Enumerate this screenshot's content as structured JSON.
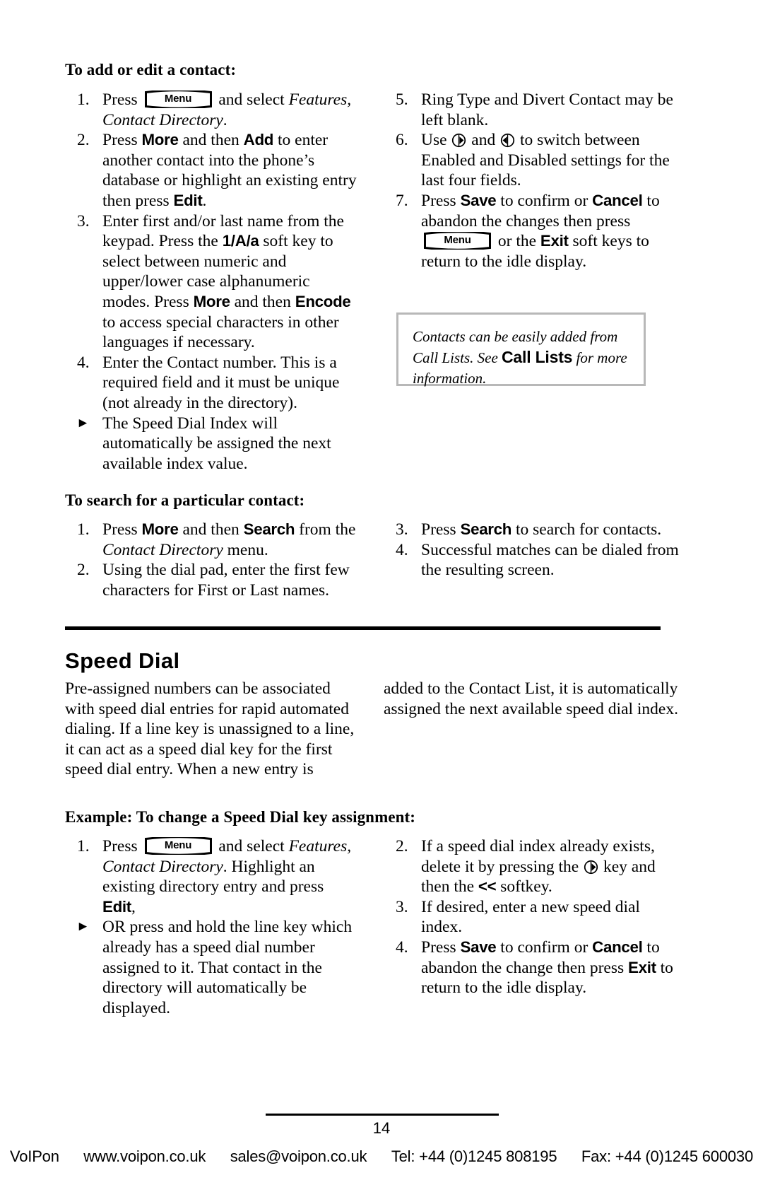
{
  "page": {
    "number": "14"
  },
  "sections": {
    "add_edit": {
      "heading": "To add or edit a contact:",
      "left_items": [
        {
          "marker": "1.",
          "parts": [
            {
              "t": "text",
              "v": "Press "
            },
            {
              "t": "menukey",
              "v": "Menu"
            },
            {
              "t": "text",
              "v": " and select "
            },
            {
              "t": "italic",
              "v": "Features, Contact Directory"
            },
            {
              "t": "text",
              "v": "."
            }
          ]
        },
        {
          "marker": "2.",
          "parts": [
            {
              "t": "text",
              "v": "Press "
            },
            {
              "t": "softkey",
              "v": "More"
            },
            {
              "t": "text",
              "v": " and then "
            },
            {
              "t": "softkey",
              "v": "Add"
            },
            {
              "t": "text",
              "v": " to enter another contact into the phone’s database or highlight an existing entry then press "
            },
            {
              "t": "softkey",
              "v": "Edit"
            },
            {
              "t": "text",
              "v": "."
            }
          ]
        },
        {
          "marker": "3.",
          "parts": [
            {
              "t": "text",
              "v": "Enter first and/or last name from the keypad.  Press the "
            },
            {
              "t": "softkey",
              "v": "1/A/a"
            },
            {
              "t": "text",
              "v": " soft key to select between numeric and upper/lower case alphanumeric modes.  Press "
            },
            {
              "t": "softkey",
              "v": "More"
            },
            {
              "t": "text",
              "v": " and then "
            },
            {
              "t": "softkey",
              "v": "Encode"
            },
            {
              "t": "text",
              "v": "  to access special characters in other languages if necessary."
            }
          ]
        },
        {
          "marker": "4.",
          "parts": [
            {
              "t": "text",
              "v": "Enter the Contact number.  This is a required field and it must be unique (not already in the directory)."
            }
          ]
        },
        {
          "marker": "►",
          "parts": [
            {
              "t": "text",
              "v": "The Speed Dial Index will automatically be assigned the next available index value."
            }
          ]
        }
      ],
      "right_items": [
        {
          "marker": "5.",
          "parts": [
            {
              "t": "text",
              "v": "Ring Type and Divert Contact may be left blank."
            }
          ]
        },
        {
          "marker": "6.",
          "parts": [
            {
              "t": "text",
              "v": "Use "
            },
            {
              "t": "navkey",
              "v": "right-nav-key"
            },
            {
              "t": "text",
              "v": " and "
            },
            {
              "t": "navkey-left",
              "v": "left-nav-key"
            },
            {
              "t": "text",
              "v": " to switch between Enabled and Disabled settings for the last four fields."
            }
          ]
        },
        {
          "marker": "7.",
          "parts": [
            {
              "t": "text",
              "v": "Press "
            },
            {
              "t": "softkey",
              "v": "Save"
            },
            {
              "t": "text",
              "v": " to confirm or "
            },
            {
              "t": "softkey",
              "v": "Cancel"
            },
            {
              "t": "text",
              "v": " to abandon the changes then press "
            },
            {
              "t": "menukey",
              "v": "Menu"
            },
            {
              "t": "text",
              "v": " or the "
            },
            {
              "t": "softkey",
              "v": "Exit"
            },
            {
              "t": "text",
              "v": " soft keys to return to the idle display."
            }
          ]
        }
      ]
    },
    "note": {
      "line1": "Contacts can be easily added from",
      "line2a": "Call Lists.  See ",
      "line2b": "Call Lists",
      "line2c": " for more",
      "line3": "information."
    },
    "search": {
      "heading": "To search for a particular contact:",
      "left_items": [
        {
          "marker": "1.",
          "parts": [
            {
              "t": "text",
              "v": "Press "
            },
            {
              "t": "softkey",
              "v": "More"
            },
            {
              "t": "text",
              "v": " and then "
            },
            {
              "t": "softkey",
              "v": "Search"
            },
            {
              "t": "text",
              "v": " from the "
            },
            {
              "t": "italic",
              "v": "Contact Directory"
            },
            {
              "t": "text",
              "v": " menu."
            }
          ]
        },
        {
          "marker": "2.",
          "parts": [
            {
              "t": "text",
              "v": "Using the dial pad, enter the first few characters for First or Last names."
            }
          ]
        }
      ],
      "right_items": [
        {
          "marker": "3.",
          "parts": [
            {
              "t": "text",
              "v": "Press "
            },
            {
              "t": "softkey",
              "v": "Search"
            },
            {
              "t": "text",
              "v": " to search for contacts."
            }
          ]
        },
        {
          "marker": "4.",
          "parts": [
            {
              "t": "text",
              "v": "Successful matches can be dialed from the resulting screen."
            }
          ]
        }
      ]
    },
    "speed_dial": {
      "heading": "Speed Dial",
      "paragraph_left": "Pre-assigned numbers can be associated with speed dial entries for rapid automated dialing.  If a line key is unassigned to a line, it can act as a speed dial key for the first speed dial entry.  When a new entry is",
      "paragraph_right": "added to the Contact List, it is automatically assigned the next available speed dial index."
    },
    "example": {
      "heading": "Example: To change a Speed Dial key assignment:",
      "left_items": [
        {
          "marker": "1.",
          "parts": [
            {
              "t": "text",
              "v": "Press "
            },
            {
              "t": "menukey",
              "v": "Menu"
            },
            {
              "t": "text",
              "v": " and select "
            },
            {
              "t": "italic",
              "v": "Features, Contact Directory"
            },
            {
              "t": "text",
              "v": ".  Highlight an existing directory entry and press "
            },
            {
              "t": "softkey",
              "v": "Edit"
            },
            {
              "t": "text",
              "v": ","
            }
          ]
        },
        {
          "marker": "►",
          "parts": [
            {
              "t": "text",
              "v": "OR press and hold the line key which already has a speed dial number assigned to it.  That contact in the directory will automatically be displayed."
            }
          ]
        }
      ],
      "right_items": [
        {
          "marker": "2.",
          "parts": [
            {
              "t": "text",
              "v": "If a speed dial index already exists, delete it by pressing the "
            },
            {
              "t": "navkey",
              "v": "right-nav-key"
            },
            {
              "t": "text",
              "v": " key and then the "
            },
            {
              "t": "softkey",
              "v": "<<"
            },
            {
              "t": "text",
              "v": " softkey."
            }
          ]
        },
        {
          "marker": "3.",
          "parts": [
            {
              "t": "text",
              "v": "If desired, enter a new speed dial index."
            }
          ]
        },
        {
          "marker": "4.",
          "parts": [
            {
              "t": "text",
              "v": "Press "
            },
            {
              "t": "softkey",
              "v": "Save"
            },
            {
              "t": "text",
              "v": " to confirm or "
            },
            {
              "t": "softkey",
              "v": "Cancel"
            },
            {
              "t": "text",
              "v": " to abandon the change then press "
            },
            {
              "t": "softkey",
              "v": "Exit"
            },
            {
              "t": "text",
              "v": " to return to the idle display."
            }
          ]
        }
      ]
    }
  },
  "footer": {
    "company": "VoIPon",
    "website": "www.voipon.co.uk",
    "email": "sales@voipon.co.uk",
    "telephone": "Tel: +44 (0)1245 808195",
    "fax": "Fax: +44 (0)1245 600030"
  },
  "colors": {
    "text": "#000000",
    "note_border": "#b8b8b8",
    "page_background": "#ffffff"
  }
}
